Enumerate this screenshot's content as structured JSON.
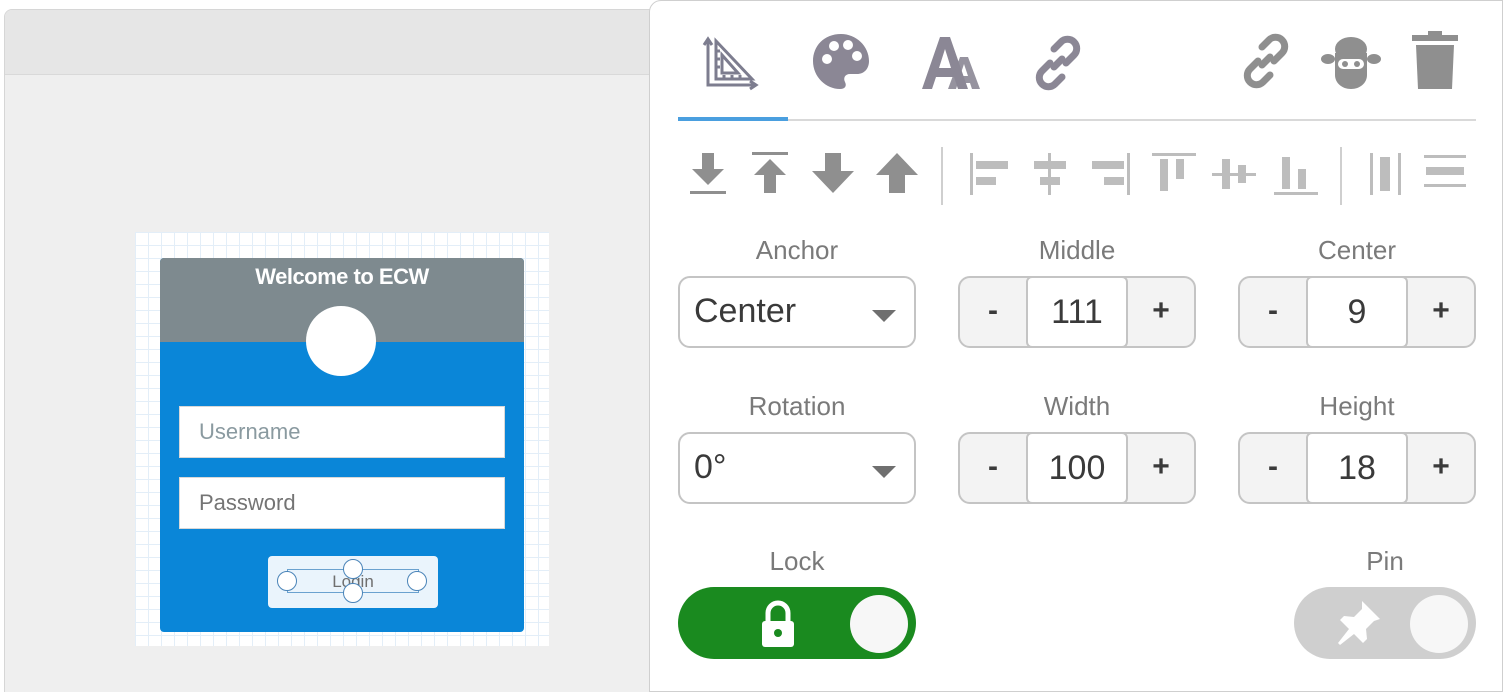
{
  "canvas": {
    "mock_title": "Welcome to ECW",
    "username_placeholder": "Username",
    "password_placeholder": "Password",
    "login_label": "Login"
  },
  "panel": {
    "tabs": [
      {
        "icon": "layout-icon",
        "active": true
      },
      {
        "icon": "palette-icon"
      },
      {
        "icon": "font-icon"
      },
      {
        "icon": "link-icon"
      }
    ],
    "actions": [
      {
        "icon": "link-icon"
      },
      {
        "icon": "sheep-icon"
      },
      {
        "icon": "trash-icon"
      }
    ],
    "toolbar_icons": [
      "send-to-back-icon",
      "bring-to-front-icon",
      "send-backward-icon",
      "bring-forward-icon",
      "align-left-icon",
      "align-center-icon",
      "align-right-icon",
      "align-top-icon",
      "align-middle-icon",
      "align-bottom-icon",
      "distribute-horizontal-icon",
      "distribute-vertical-icon"
    ],
    "anchor": {
      "label": "Anchor",
      "value": "Center"
    },
    "middle": {
      "label": "Middle",
      "value": "111"
    },
    "center": {
      "label": "Center",
      "value": "9"
    },
    "rotation": {
      "label": "Rotation",
      "value": "0°"
    },
    "width": {
      "label": "Width",
      "value": "100"
    },
    "height": {
      "label": "Height",
      "value": "18"
    },
    "stepper": {
      "minus": "-",
      "plus": "+"
    },
    "lock": {
      "label": "Lock",
      "on": true
    },
    "pin": {
      "label": "Pin",
      "on": false
    },
    "colors": {
      "accent": "#4a9fdf",
      "lock_on": "#1a8a1f",
      "toggle_off": "#cfcfcf",
      "icon": "#8f8f8f"
    }
  }
}
